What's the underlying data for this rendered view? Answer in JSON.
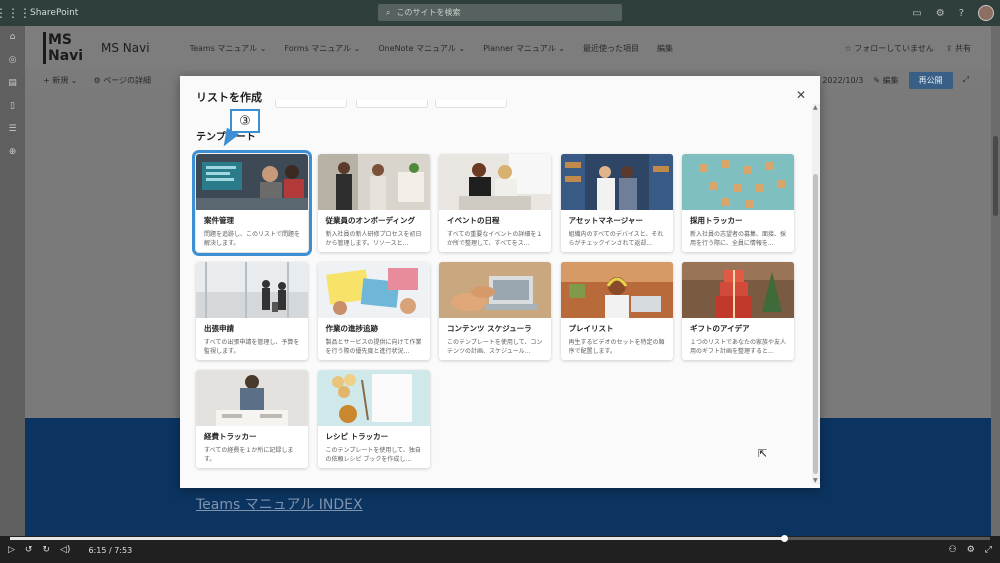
{
  "suite": {
    "title": "SharePoint",
    "search_placeholder": "このサイトを検索"
  },
  "site": {
    "logo_text": "MS Navi",
    "name": "MS Navi",
    "nav": [
      "Teams マニュアル ⌄",
      "Forms マニュアル ⌄",
      "OneNote マニュアル ⌄",
      "Planner マニュアル ⌄",
      "最近使った項目",
      "編集"
    ],
    "follow": "☆ フォローしていません",
    "share": "⇪ 共有"
  },
  "cmdbar": {
    "new": "+ 新規 ⌄",
    "page_details": "⚙ ページの詳細",
    "saved": "時 2022/10/3",
    "edit": "✎ 編集",
    "republish": "再公開"
  },
  "modal": {
    "title": "リストを作成",
    "section": "テンプレート",
    "templates": [
      {
        "title": "案件管理",
        "desc": "問題を追跡し、このリストで問題を解決します。"
      },
      {
        "title": "従業員のオンボーディング",
        "desc": "新入社員の新人研修プロセスを初日から管理します。リソースと..."
      },
      {
        "title": "イベントの日程",
        "desc": "すべての重要なイベントの詳細を１か所で整理して、すべてをス..."
      },
      {
        "title": "アセットマネージャー",
        "desc": "組織内のすべてのデバイスと、それらがチェックインされて返却..."
      },
      {
        "title": "採用トラッカー",
        "desc": "新入社員の志望者の募集、面接、採用を行う際に、全員に情報を..."
      },
      {
        "title": "出張申請",
        "desc": "すべての出張申請を管理し、予算を監視します。"
      },
      {
        "title": "作業の進捗追跡",
        "desc": "製品とサービスの提供に向けて作業を行う際の優先度と進行状況..."
      },
      {
        "title": "コンテンツ スケジューラ",
        "desc": "このテンプレートを使用して、コンテンツの計画、スケジュール..."
      },
      {
        "title": "プレイリスト",
        "desc": "再生するビデオのセットを特定の順序で配置します。"
      },
      {
        "title": "ギフトのアイデア",
        "desc": "１つのリストであなたの家族や友人用のギフト計画を整理すると..."
      },
      {
        "title": "経費トラッカー",
        "desc": "すべての経費を１か所に記録します。"
      },
      {
        "title": "レシピ トラッカー",
        "desc": "このテンプレートを使用して、独自の依頼レシピ ブックを作成し..."
      }
    ]
  },
  "callout": {
    "label": "③"
  },
  "page": {
    "index_link": "Teams マニュアル INDEX"
  },
  "video": {
    "time": "6:15 / 7:53",
    "progress_fraction": 0.79
  },
  "colors": {
    "accent": "#3d8fd4",
    "suitebar": "#2f3f3c",
    "band": "#0b3460"
  }
}
